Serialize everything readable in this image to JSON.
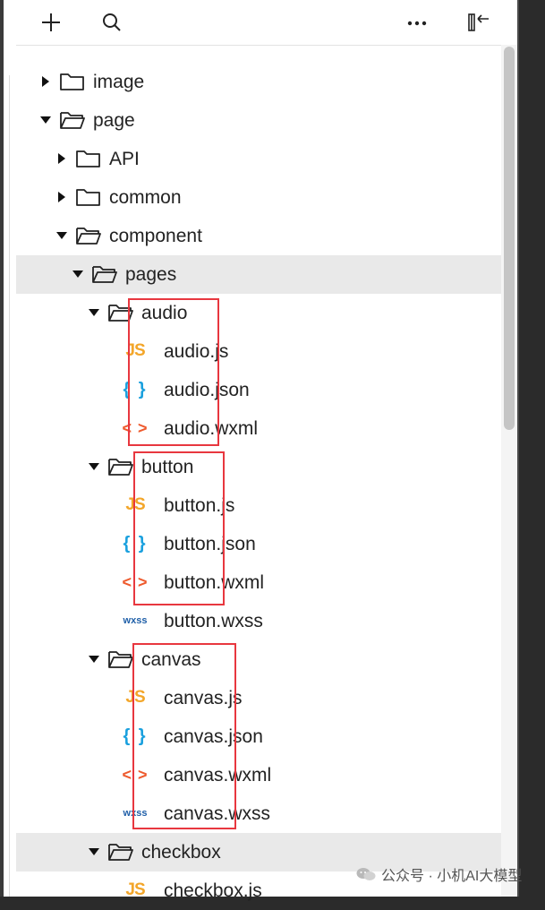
{
  "toolbar": {
    "buttons": [
      {
        "icon": "plus-icon"
      },
      {
        "icon": "search-icon"
      },
      {
        "icon": "more-icon"
      },
      {
        "icon": "collapse-panel-icon"
      }
    ]
  },
  "colors": {
    "js": "#f3a62a",
    "json": "#1aa0de",
    "wxml": "#ee5a2d",
    "wxss": "#1f5fa8",
    "highlight": "#e8373f",
    "selected_row": "#e9e9e9"
  },
  "file_icons": {
    "js": "JS",
    "json": "{ }",
    "wxml": "< >",
    "wxss": "wxss"
  },
  "tree": [
    {
      "label": "image",
      "type": "folder",
      "expanded": false
    },
    {
      "label": "page",
      "type": "folder",
      "expanded": true
    },
    {
      "label": "API",
      "type": "folder",
      "expanded": false
    },
    {
      "label": "common",
      "type": "folder",
      "expanded": false
    },
    {
      "label": "component",
      "type": "folder",
      "expanded": true
    },
    {
      "label": "pages",
      "type": "folder",
      "expanded": true,
      "selected": true
    },
    {
      "label": "audio",
      "type": "folder",
      "expanded": true
    },
    {
      "label": "audio.js",
      "type": "js"
    },
    {
      "label": "audio.json",
      "type": "json"
    },
    {
      "label": "audio.wxml",
      "type": "wxml"
    },
    {
      "label": "button",
      "type": "folder",
      "expanded": true
    },
    {
      "label": "button.js",
      "type": "js"
    },
    {
      "label": "button.json",
      "type": "json"
    },
    {
      "label": "button.wxml",
      "type": "wxml"
    },
    {
      "label": "button.wxss",
      "type": "wxss"
    },
    {
      "label": "canvas",
      "type": "folder",
      "expanded": true
    },
    {
      "label": "canvas.js",
      "type": "js"
    },
    {
      "label": "canvas.json",
      "type": "json"
    },
    {
      "label": "canvas.wxml",
      "type": "wxml"
    },
    {
      "label": "canvas.wxss",
      "type": "wxss"
    },
    {
      "label": "checkbox",
      "type": "folder",
      "expanded": true,
      "selected": true
    },
    {
      "label": "checkbox.js",
      "type": "js"
    }
  ],
  "watermark": {
    "text": "公众号 · 小机AI大模型"
  }
}
